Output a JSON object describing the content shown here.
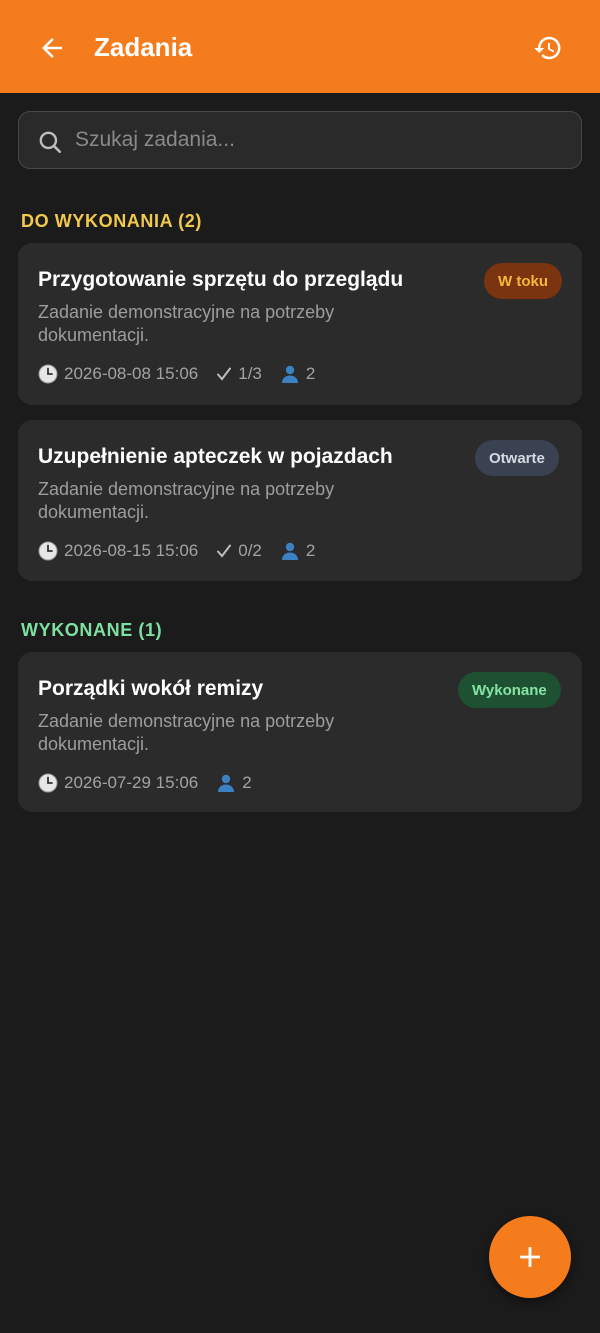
{
  "appbar": {
    "title": "Zadania",
    "back_icon": "arrow-left-icon",
    "history_icon": "history-icon",
    "background": "#f57c1c"
  },
  "search": {
    "placeholder": "Szukaj zadania...",
    "value": ""
  },
  "sections": [
    {
      "title": "DO WYKONANIA (2)",
      "color": "#f2c94c",
      "tasks": [
        {
          "title": "Przygotowanie sprzętu do przeglądu",
          "description": "Zadanie demonstracyjne na potrzeby dokumentacji.",
          "date": "2026-08-08 15:06",
          "checklist": "1/3",
          "people": "2",
          "status": "W toku",
          "status_bg": "#7a3410",
          "status_color": "#f5b83d"
        },
        {
          "title": "Uzupełnienie apteczek w pojazdach",
          "description": "Zadanie demonstracyjne na potrzeby dokumentacji.",
          "date": "2026-08-15 15:06",
          "checklist": "0/2",
          "people": "2",
          "status": "Otwarte",
          "status_bg": "#3a4251",
          "status_color": "#d5d9e0"
        }
      ]
    },
    {
      "title": "WYKONANE (1)",
      "color": "#7ee0a0",
      "tasks": [
        {
          "title": "Porządki wokół remizy",
          "description": "Zadanie demonstracyjne na potrzeby dokumentacji.",
          "date": "2026-07-29 15:06",
          "people": "2",
          "status": "Wykonane",
          "status_bg": "#1d5131",
          "status_color": "#86e3a5"
        }
      ]
    }
  ],
  "fab": {
    "icon": "plus-icon"
  }
}
